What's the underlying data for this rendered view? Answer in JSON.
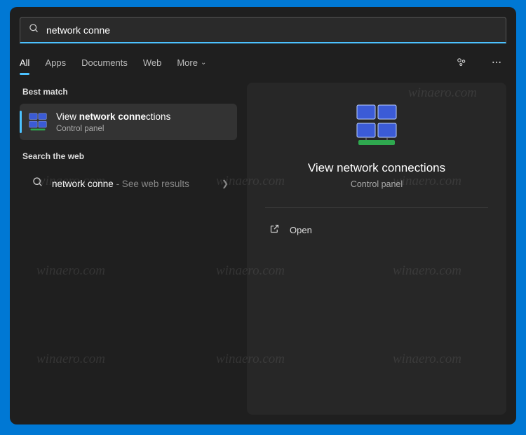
{
  "search": {
    "query": "network conne"
  },
  "tabs": {
    "all": "All",
    "apps": "Apps",
    "documents": "Documents",
    "web": "Web",
    "more": "More"
  },
  "sections": {
    "best_match": "Best match",
    "search_web": "Search the web"
  },
  "results": {
    "best": {
      "title_prefix": "View ",
      "title_highlight": "network conne",
      "title_suffix": "ctions",
      "subtitle": "Control panel"
    },
    "web": {
      "query": "network conne",
      "suffix": " - See web results"
    }
  },
  "preview": {
    "title": "View network connections",
    "subtitle": "Control panel",
    "actions": {
      "open": "Open"
    }
  },
  "watermark": "winaero.com"
}
